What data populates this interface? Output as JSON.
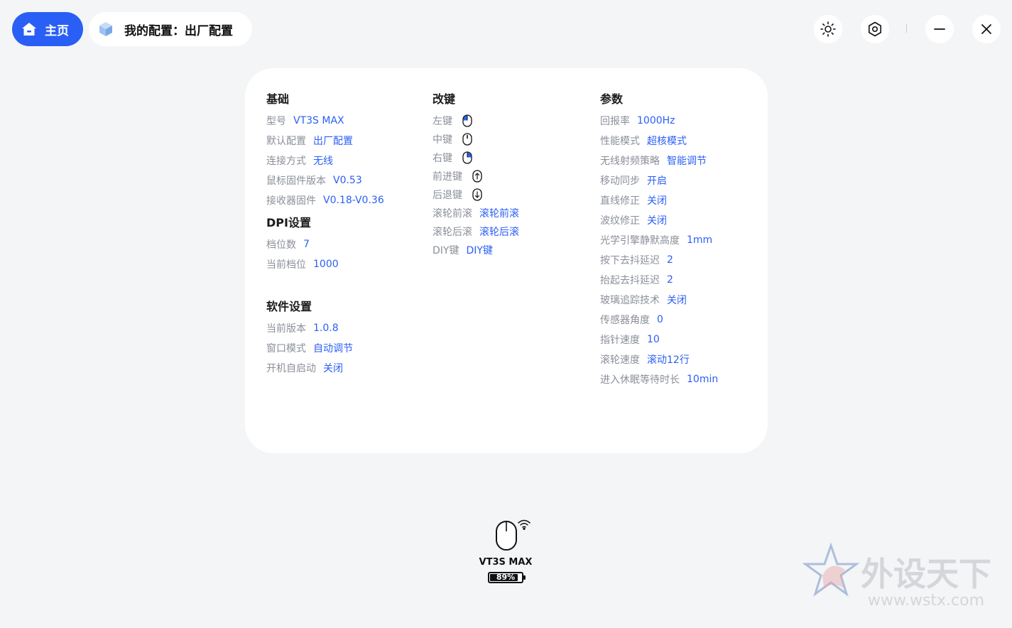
{
  "header": {
    "home_label": "主页",
    "config_title": "我的配置：出厂配置"
  },
  "colors": {
    "accent": "#2a5ff5",
    "label": "#8a8f98",
    "page_bg": "#f4f5f7",
    "card_bg": "#ffffff"
  },
  "basic": {
    "title": "基础",
    "items": [
      {
        "label": "型号",
        "value": "VT3S MAX"
      },
      {
        "label": "默认配置",
        "value": "出厂配置"
      },
      {
        "label": "连接方式",
        "value": "无线"
      },
      {
        "label": "鼠标固件版本",
        "value": "V0.53"
      },
      {
        "label": "接收器固件",
        "value": "V0.18-V0.36"
      }
    ]
  },
  "dpi": {
    "title": "DPI设置",
    "items": [
      {
        "label": "档位数",
        "value": "7"
      },
      {
        "label": "当前档位",
        "value": "1000"
      }
    ]
  },
  "software": {
    "title": "软件设置",
    "items": [
      {
        "label": "当前版本",
        "value": "1.0.8"
      },
      {
        "label": "窗口模式",
        "value": "自动调节"
      },
      {
        "label": "开机自启动",
        "value": "关闭"
      }
    ]
  },
  "keys": {
    "title": "改键",
    "items": [
      {
        "label": "左键",
        "icon": "mouse-left-icon"
      },
      {
        "label": "中键",
        "icon": "mouse-middle-icon"
      },
      {
        "label": "右键",
        "icon": "mouse-right-icon"
      },
      {
        "label": "前进键",
        "icon": "mouse-forward-icon"
      },
      {
        "label": "后退键",
        "icon": "mouse-back-icon"
      },
      {
        "label": "滚轮前滚",
        "value": "滚轮前滚"
      },
      {
        "label": "滚轮后滚",
        "value": "滚轮后滚"
      },
      {
        "label": "DIY键",
        "value": "DIY键"
      }
    ]
  },
  "params": {
    "title": "参数",
    "items": [
      {
        "label": "回报率",
        "value": "1000Hz"
      },
      {
        "label": "性能模式",
        "value": "超核模式"
      },
      {
        "label": "无线射频策略",
        "value": "智能调节"
      },
      {
        "label": "移动同步",
        "value": "开启"
      },
      {
        "label": "直线修正",
        "value": "关闭"
      },
      {
        "label": "波纹修正",
        "value": "关闭"
      },
      {
        "label": "光学引擎静默高度",
        "value": "1mm"
      },
      {
        "label": "按下去抖延迟",
        "value": "2"
      },
      {
        "label": "抬起去抖延迟",
        "value": "2"
      },
      {
        "label": "玻璃追踪技术",
        "value": "关闭"
      },
      {
        "label": "传感器角度",
        "value": "0"
      },
      {
        "label": "指针速度",
        "value": "10"
      },
      {
        "label": "滚轮速度",
        "value": "滚动12行"
      },
      {
        "label": "进入休眠等待时长",
        "value": "10min"
      }
    ]
  },
  "device": {
    "name": "VT3S MAX",
    "battery_text": "89%",
    "battery_level": 0.89
  },
  "watermark": {
    "text": "外设天下",
    "url": "www.wstx.com"
  }
}
